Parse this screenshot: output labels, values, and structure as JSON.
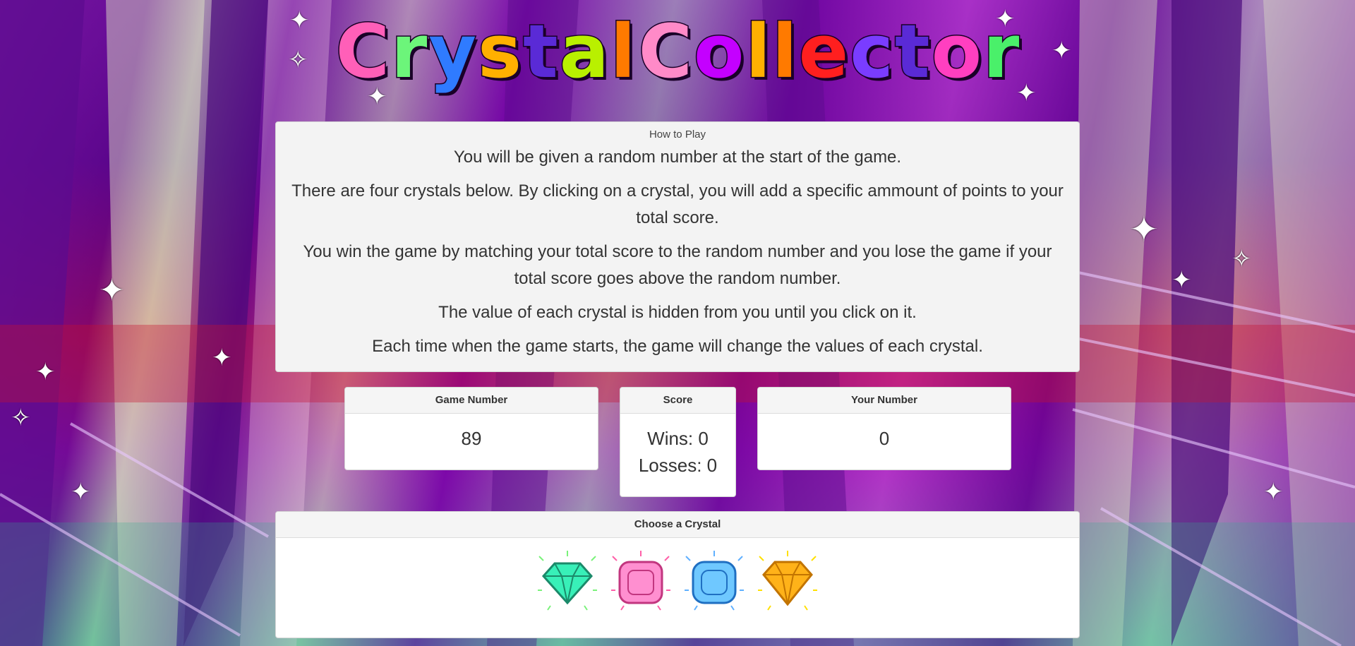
{
  "title": {
    "letters": [
      {
        "ch": "C",
        "color": "#ff5fb8"
      },
      {
        "ch": "r",
        "color": "#6cf57a"
      },
      {
        "ch": "y",
        "color": "#2f7bff"
      },
      {
        "ch": "s",
        "color": "#ffb000"
      },
      {
        "ch": "t",
        "color": "#5a2ad6"
      },
      {
        "ch": "a",
        "color": "#b9f000"
      },
      {
        "ch": "l",
        "color": "#ff7a00"
      },
      {
        "ch": " ",
        "color": "#000000"
      },
      {
        "ch": "C",
        "color": "#ff8ac8"
      },
      {
        "ch": "o",
        "color": "#c400ff"
      },
      {
        "ch": "l",
        "color": "#ffb000"
      },
      {
        "ch": "l",
        "color": "#ff7a00"
      },
      {
        "ch": "e",
        "color": "#ff1f1f"
      },
      {
        "ch": "c",
        "color": "#7a3cff"
      },
      {
        "ch": "t",
        "color": "#5a2ad6"
      },
      {
        "ch": "o",
        "color": "#ff3fc0"
      },
      {
        "ch": "r",
        "color": "#4af06a"
      }
    ]
  },
  "how_to_play": {
    "heading": "How to Play",
    "paragraphs": [
      "You will be given a random number at the start of the game.",
      "There are four crystals below. By clicking on a crystal, you will add a specific ammount of points to your total score.",
      "You win the game by matching your total score to the random number and you lose the game if your total score goes above the random number.",
      "The value of each crystal is hidden from you until you click on it.",
      "Each time when the game starts, the game will change the values of each crystal."
    ]
  },
  "game_number": {
    "heading": "Game Number",
    "value": "89"
  },
  "score": {
    "heading": "Score",
    "wins": "Wins: 0",
    "losses": "Losses: 0"
  },
  "your_number": {
    "heading": "Your Number",
    "value": "0"
  },
  "crystals": {
    "heading": "Choose a Crystal",
    "items": [
      {
        "name": "green-crystal",
        "color": "#38f0b8",
        "edge": "#1b8a6a",
        "spark": "#7af27a"
      },
      {
        "name": "pink-crystal",
        "color": "#ff8fd0",
        "edge": "#c2367f",
        "spark": "#ff5fa8"
      },
      {
        "name": "blue-crystal",
        "color": "#6fc8ff",
        "edge": "#1f6fc2",
        "spark": "#5fb0ff"
      },
      {
        "name": "orange-crystal",
        "color": "#ffb219",
        "edge": "#c27400",
        "spark": "#ffe000"
      }
    ]
  }
}
